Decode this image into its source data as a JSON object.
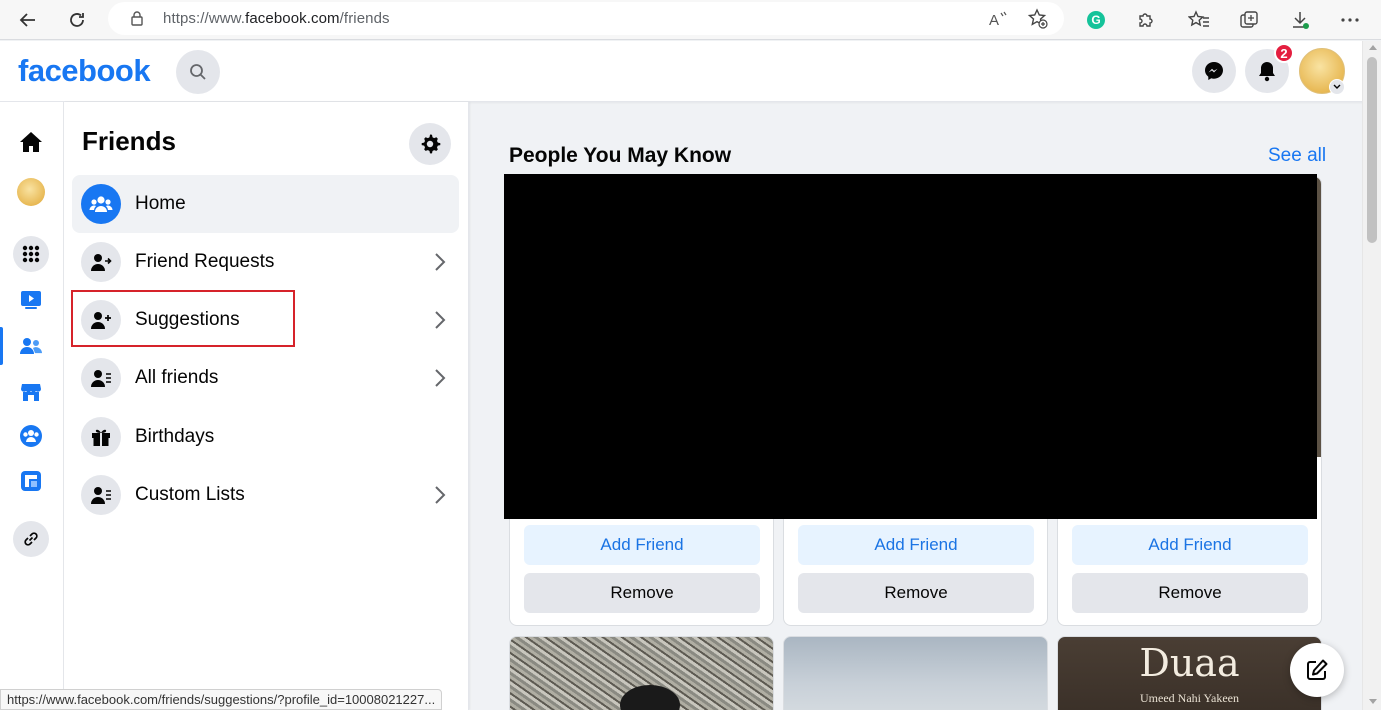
{
  "browser": {
    "url_prefix": "https://www.",
    "url_host": "facebook.com",
    "url_path": "/friends",
    "status_url": "https://www.facebook.com/friends/suggestions/?profile_id=10008021227..."
  },
  "header": {
    "logo": "facebook",
    "notifications_count": "2"
  },
  "sidebar": {
    "title": "Friends",
    "items": [
      {
        "label": "Home",
        "icon": "friends-home-icon",
        "chevron": false,
        "active": true
      },
      {
        "label": "Friend Requests",
        "icon": "friend-request-icon",
        "chevron": true
      },
      {
        "label": "Suggestions",
        "icon": "add-friend-icon",
        "chevron": true
      },
      {
        "label": "All friends",
        "icon": "friends-list-icon",
        "chevron": true
      },
      {
        "label": "Birthdays",
        "icon": "gift-icon",
        "chevron": false
      },
      {
        "label": "Custom Lists",
        "icon": "custom-list-icon",
        "chevron": true
      }
    ]
  },
  "main": {
    "section_title": "People You May Know",
    "see_all": "See all",
    "cards": [
      {
        "add_label": "Add Friend",
        "remove_label": "Remove"
      },
      {
        "add_label": "Add Friend",
        "remove_label": "Remove"
      },
      {
        "add_label": "Add Friend",
        "remove_label": "Remove"
      }
    ],
    "second_row": {
      "card3_title": "Duaa",
      "card3_subtitle": "Umeed Nahi Yakeen"
    }
  },
  "colors": {
    "brand": "#1877f2",
    "highlight": "#d6232a",
    "badge": "#e41e3f"
  }
}
